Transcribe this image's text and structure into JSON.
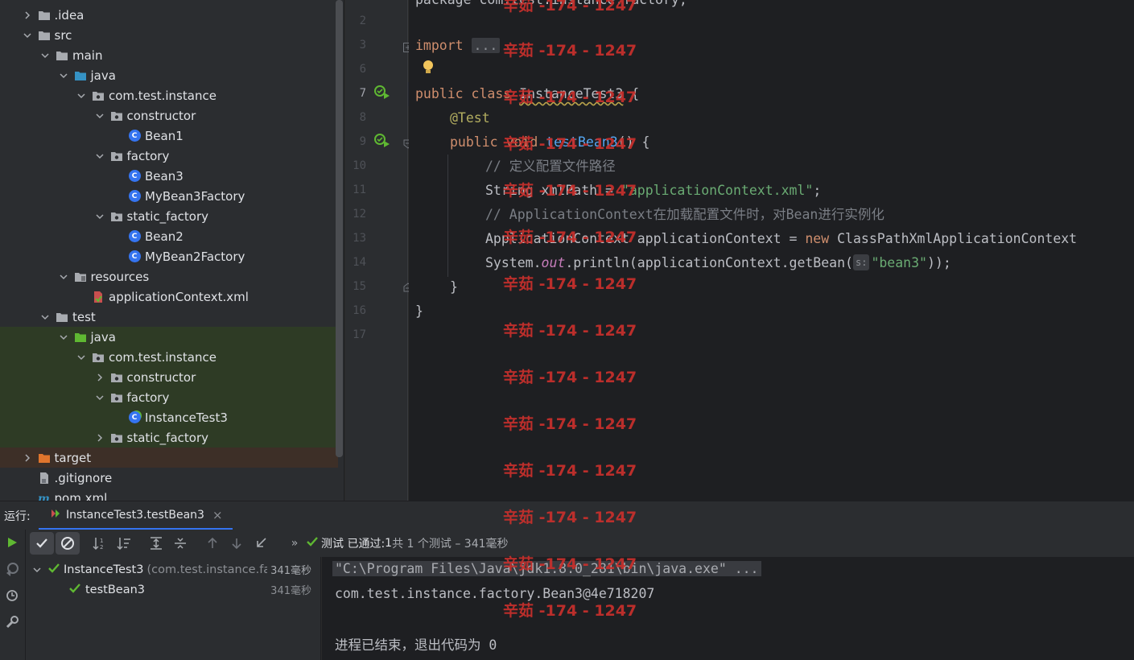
{
  "project_tree": [
    {
      "label": ".idea",
      "depth": 1,
      "expanded": false,
      "type": "folder"
    },
    {
      "label": "src",
      "depth": 1,
      "expanded": true,
      "type": "folder"
    },
    {
      "label": "main",
      "depth": 2,
      "expanded": true,
      "type": "folder"
    },
    {
      "label": "java",
      "depth": 3,
      "expanded": true,
      "type": "source-folder"
    },
    {
      "label": "com.test.instance",
      "depth": 4,
      "expanded": true,
      "type": "package"
    },
    {
      "label": "constructor",
      "depth": 5,
      "expanded": true,
      "type": "package"
    },
    {
      "label": "Bean1",
      "depth": 6,
      "type": "class"
    },
    {
      "label": "factory",
      "depth": 5,
      "expanded": true,
      "type": "package"
    },
    {
      "label": "Bean3",
      "depth": 6,
      "type": "class"
    },
    {
      "label": "MyBean3Factory",
      "depth": 6,
      "type": "class"
    },
    {
      "label": "static_factory",
      "depth": 5,
      "expanded": true,
      "type": "package"
    },
    {
      "label": "Bean2",
      "depth": 6,
      "type": "class"
    },
    {
      "label": "MyBean2Factory",
      "depth": 6,
      "type": "class"
    },
    {
      "label": "resources",
      "depth": 3,
      "expanded": true,
      "type": "resources-folder"
    },
    {
      "label": "applicationContext.xml",
      "depth": 4,
      "type": "xml"
    },
    {
      "label": "test",
      "depth": 2,
      "expanded": true,
      "type": "folder"
    },
    {
      "label": "java",
      "depth": 3,
      "expanded": true,
      "type": "test-folder",
      "zone": "test"
    },
    {
      "label": "com.test.instance",
      "depth": 4,
      "expanded": true,
      "type": "package",
      "zone": "test"
    },
    {
      "label": "constructor",
      "depth": 5,
      "expanded": false,
      "type": "package",
      "zone": "test"
    },
    {
      "label": "factory",
      "depth": 5,
      "expanded": true,
      "type": "package",
      "zone": "test"
    },
    {
      "label": "InstanceTest3",
      "depth": 6,
      "type": "test-class",
      "zone": "test"
    },
    {
      "label": "static_factory",
      "depth": 5,
      "expanded": false,
      "type": "package",
      "zone": "test"
    },
    {
      "label": "target",
      "depth": 1,
      "expanded": false,
      "type": "excluded-folder",
      "zone": "excluded"
    },
    {
      "label": ".gitignore",
      "depth": 1,
      "type": "gitignore"
    },
    {
      "label": "pom.xml",
      "depth": 1,
      "type": "maven"
    }
  ],
  "editor": {
    "lines": [
      {
        "n": "2",
        "text": ""
      },
      {
        "n": "3",
        "text": "import ..."
      },
      {
        "n": "6",
        "text": ""
      },
      {
        "n": "7",
        "text": "public class InstanceTest3 {"
      },
      {
        "n": "8",
        "text": "@Test"
      },
      {
        "n": "9",
        "text": "public void testBean3() {"
      },
      {
        "n": "10",
        "text": "// 定义配置文件路径"
      },
      {
        "n": "11",
        "text": "String xmlPath = \"applicationContext.xml\";"
      },
      {
        "n": "12",
        "text": "// ApplicationContext在加载配置文件时，对Bean进行实例化"
      },
      {
        "n": "13",
        "text": "ApplicationContext applicationContext = new ClassPathXmlApplicationContext"
      },
      {
        "n": "14",
        "text": "System.out.println(applicationContext.getBean(s: \"bean3\"));"
      },
      {
        "n": "15",
        "text": "}"
      },
      {
        "n": "16",
        "text": "}"
      },
      {
        "n": "17",
        "text": ""
      }
    ],
    "top_partial": "package com.test.instance.factory;"
  },
  "code": {
    "l3_kw": "import",
    "l3_fold": "...",
    "l7_kw1": "public",
    "l7_kw2": "class",
    "l7_name": "InstanceTest3",
    "l7_rest": " {",
    "l8_ann": "@Test",
    "l9_kw1": "public",
    "l9_kw2": "void",
    "l9_name": "testBean3",
    "l9_rest": "() {",
    "l10_cmt": "// 定义配置文件路径",
    "l11_a": "String xmlPath = ",
    "l11_str": "\"applicationContext.xml\"",
    "l11_b": ";",
    "l12_cmt": "// ApplicationContext在加载配置文件时，对Bean进行实例化",
    "l13_a": "ApplicationContext applicationContext = ",
    "l13_kw": "new",
    "l13_b": " ClassPathXmlApplicationContext",
    "l14_a": "System.",
    "l14_fld": "out",
    "l14_b": ".println(applicationContext.getBean(",
    "l14_hint": "s:",
    "l14_str": "\"bean3\"",
    "l14_c": "));",
    "l15": "}",
    "l16": "}"
  },
  "watermark": "辛茹 -174 - 1247",
  "run": {
    "label": "运行:",
    "tab_title": "InstanceTest3.testBean3",
    "status_prefix": "测试 已通过: ",
    "status_count": "1",
    "status_suffix": "共 1 个测试 – 341毫秒",
    "tree": {
      "root_name": "InstanceTest3",
      "root_pkg": "(com.test.instance.fa",
      "root_time": "341毫秒",
      "child_name": "testBean3",
      "child_time": "341毫秒"
    },
    "console": [
      "\"C:\\Program Files\\Java\\jdk1.8.0_281\\bin\\java.exe\" ...",
      "com.test.instance.factory.Bean3@4e718207",
      "",
      "进程已结束，退出代码为 0"
    ]
  },
  "colors": {
    "accent": "#3574f0",
    "success": "#5fb832",
    "watermark": "#c9302c"
  }
}
